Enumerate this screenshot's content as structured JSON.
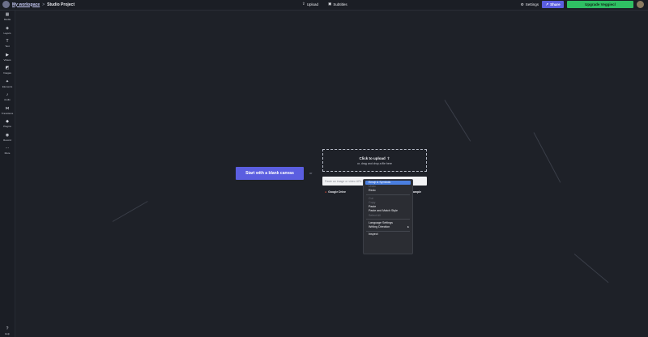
{
  "topbar": {
    "workspace": "My workspace",
    "separator": ">",
    "project": "Studio Project",
    "upload": "Upload",
    "subtitles": "Subtitles",
    "settings": "Settings",
    "share": "Share",
    "upgrade": "Upgrade Veggiecl"
  },
  "sidebar": {
    "items": [
      {
        "label": "Media",
        "icon": "media-icon"
      },
      {
        "label": "Layers",
        "icon": "layers-icon"
      },
      {
        "label": "Text",
        "icon": "text-icon"
      },
      {
        "label": "Videos",
        "icon": "videos-icon"
      },
      {
        "label": "Images",
        "icon": "images-icon"
      },
      {
        "label": "Elements",
        "icon": "elements-icon"
      },
      {
        "label": "Audio",
        "icon": "audio-icon"
      },
      {
        "label": "Transitions",
        "icon": "transitions-icon"
      },
      {
        "label": "Plugins",
        "icon": "plugins-icon"
      },
      {
        "label": "Record",
        "icon": "record-icon"
      },
      {
        "label": "More",
        "icon": "more-icon"
      }
    ],
    "help": "Help"
  },
  "main": {
    "blank_canvas": "Start with a blank canvas",
    "or": "or",
    "upload_title": "Click to upload",
    "upload_sub": "or, drag and drop a file here",
    "url_placeholder": "Paste an image or video URL",
    "source_drive": "Google Drive",
    "sample": "sample"
  },
  "context_menu": {
    "items": [
      {
        "label": "Emoji & Symbols",
        "state": "highlight"
      },
      {
        "label": "Undo",
        "state": "disabled"
      },
      {
        "label": "Redo",
        "state": "normal"
      },
      {
        "sep": true
      },
      {
        "label": "Cut",
        "state": "disabled"
      },
      {
        "label": "Copy",
        "state": "disabled"
      },
      {
        "label": "Paste",
        "state": "normal"
      },
      {
        "label": "Paste and Match Style",
        "state": "normal"
      },
      {
        "label": "Select All",
        "state": "disabled"
      },
      {
        "sep": true
      },
      {
        "label": "Language Settings",
        "state": "normal"
      },
      {
        "label": "Writing Direction",
        "state": "normal",
        "submenu": true
      },
      {
        "sep": true
      },
      {
        "label": "Inspect",
        "state": "normal"
      }
    ]
  },
  "colors": {
    "accent": "#5b5ee0",
    "upgrade": "#2fbf63",
    "background": "#1e2128",
    "menu_highlight": "#4a7fe0"
  }
}
